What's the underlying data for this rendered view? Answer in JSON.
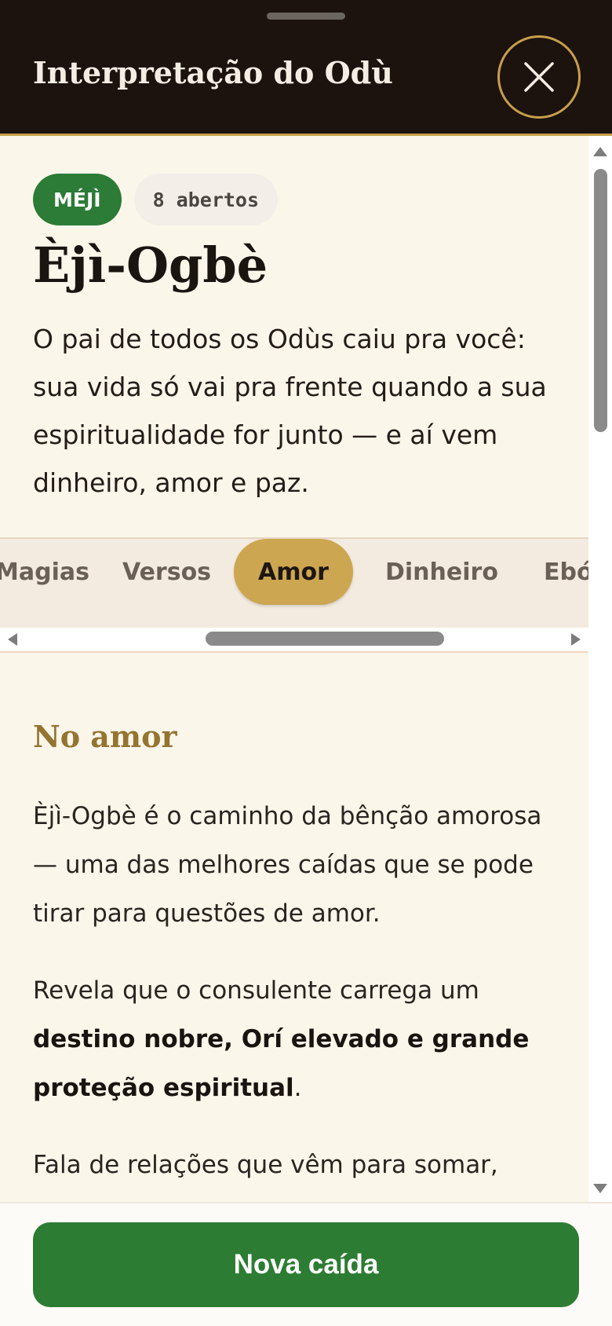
{
  "header": {
    "title": "Interpretação do Odù",
    "close_icon": "close-icon"
  },
  "odu": {
    "badge": "MÉJÌ",
    "count": "8 abertos",
    "name": "Èjì-Ogbè",
    "summary": "O pai de todos os Odùs caiu pra você: sua vida só vai pra frente quando a sua espiritualidade for junto — e aí vem dinheiro, amor e paz."
  },
  "tabs": {
    "items": [
      "Magias",
      "Versos",
      "Amor",
      "Dinheiro",
      "Ebó"
    ],
    "active": "Amor"
  },
  "section": {
    "title": "No amor",
    "p1": "Èjì-Ogbè é o caminho da bênção amorosa — uma das melhores caídas que se pode tirar para questões de amor.",
    "p2_prefix": "Revela que o consulente carrega um ",
    "p2_bold": "destino nobre, Orí elevado e grande proteção espiritual",
    "p2_suffix": ".",
    "p3": "Fala de relações que vêm para somar,"
  },
  "footer": {
    "button_label": "Nova caída"
  },
  "colors": {
    "header_bg": "#1c120e",
    "accent_gold": "#c79f4b",
    "primary_green": "#2d7c33",
    "page_bg": "#fbf6ea",
    "tab_active": "#cda651"
  }
}
